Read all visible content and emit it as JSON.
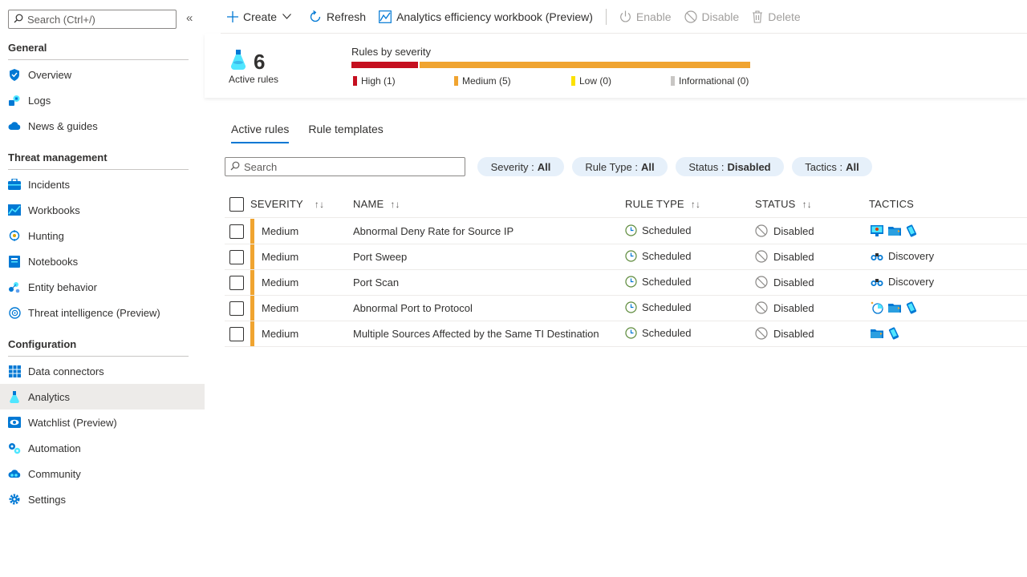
{
  "sidebar": {
    "search_placeholder": "Search (Ctrl+/)",
    "collapse_glyph": "«",
    "sections": {
      "general": "General",
      "threat": "Threat management",
      "config": "Configuration"
    },
    "items": [
      {
        "label": "Overview",
        "icon": "shield-icon"
      },
      {
        "label": "Logs",
        "icon": "logs-icon"
      },
      {
        "label": "News & guides",
        "icon": "cloud-icon"
      },
      {
        "label": "Incidents",
        "icon": "briefcase-icon"
      },
      {
        "label": "Workbooks",
        "icon": "chart-icon"
      },
      {
        "label": "Hunting",
        "icon": "target-icon"
      },
      {
        "label": "Notebooks",
        "icon": "notebook-icon"
      },
      {
        "label": "Entity behavior",
        "icon": "entity-icon"
      },
      {
        "label": "Threat intelligence (Preview)",
        "icon": "globe-icon"
      },
      {
        "label": "Data connectors",
        "icon": "grid-icon"
      },
      {
        "label": "Analytics",
        "icon": "flask-icon",
        "selected": true
      },
      {
        "label": "Watchlist (Preview)",
        "icon": "eye-icon"
      },
      {
        "label": "Automation",
        "icon": "gears-icon"
      },
      {
        "label": "Community",
        "icon": "community-icon"
      },
      {
        "label": "Settings",
        "icon": "gear-icon"
      }
    ]
  },
  "toolbar": {
    "create": "Create",
    "refresh": "Refresh",
    "workbook": "Analytics efficiency workbook (Preview)",
    "enable": "Enable",
    "disable": "Disable",
    "delete": "Delete"
  },
  "summary": {
    "active_count": "6",
    "active_label": "Active rules",
    "severity_title": "Rules by severity",
    "legend": [
      {
        "label": "High (1)",
        "color": "#c50f1f",
        "value": 1
      },
      {
        "label": "Medium (5)",
        "color": "#f0a430",
        "value": 5
      },
      {
        "label": "Low (0)",
        "color": "#fce100",
        "value": 0
      },
      {
        "label": "Informational (0)",
        "color": "#c8c6c4",
        "value": 0
      }
    ]
  },
  "tabs": [
    "Active rules",
    "Rule templates"
  ],
  "filters": {
    "search_placeholder": "Search",
    "severity": {
      "label": "Severity :",
      "value": "All"
    },
    "rule_type": {
      "label": "Rule Type :",
      "value": "All"
    },
    "status": {
      "label": "Status :",
      "value": "Disabled"
    },
    "tactics": {
      "label": "Tactics :",
      "value": "All"
    }
  },
  "table": {
    "headers": {
      "severity": "SEVERITY",
      "name": "NAME",
      "rule_type": "RULE TYPE",
      "status": "STATUS",
      "tactics": "TACTICS"
    },
    "sort_glyph": "↑↓",
    "rows": [
      {
        "severity": "Medium",
        "name": "Abnormal Deny Rate for Source IP",
        "rule_type": "Scheduled",
        "status": "Disabled",
        "tactics": "",
        "tactic_icons": [
          "monitor-icon",
          "folder-icon",
          "phone-icon"
        ]
      },
      {
        "severity": "Medium",
        "name": "Port Sweep",
        "rule_type": "Scheduled",
        "status": "Disabled",
        "tactics": "Discovery",
        "tactic_icons": [
          "binoculars-icon"
        ]
      },
      {
        "severity": "Medium",
        "name": "Port Scan",
        "rule_type": "Scheduled",
        "status": "Disabled",
        "tactics": "Discovery",
        "tactic_icons": [
          "binoculars-icon"
        ]
      },
      {
        "severity": "Medium",
        "name": "Abnormal Port to Protocol",
        "rule_type": "Scheduled",
        "status": "Disabled",
        "tactics": "",
        "tactic_icons": [
          "radar-icon",
          "folder-icon",
          "phone-icon"
        ]
      },
      {
        "severity": "Medium",
        "name": "Multiple Sources Affected by the Same TI Destination",
        "rule_type": "Scheduled",
        "status": "Disabled",
        "tactics": "",
        "tactic_icons": [
          "folder-icon",
          "phone-icon"
        ]
      }
    ]
  }
}
